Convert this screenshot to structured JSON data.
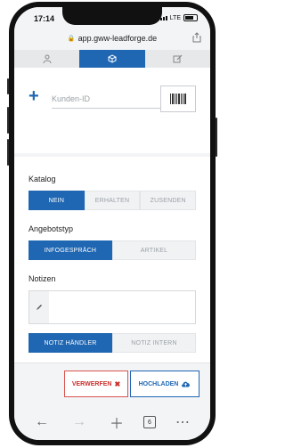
{
  "status": {
    "time": "17:14",
    "network": "LTE"
  },
  "browser": {
    "url": "app.gww-leadforge.de",
    "tab_count": "6"
  },
  "tabs": [
    {
      "icon": "user-icon"
    },
    {
      "icon": "cube-icon",
      "active": true
    },
    {
      "icon": "edit-icon"
    }
  ],
  "customer": {
    "plus": "+",
    "placeholder": "Kunden-ID"
  },
  "katalog": {
    "label": "Katalog",
    "options": [
      "NEIN",
      "ERHALTEN",
      "ZUSENDEN"
    ],
    "selected": "NEIN"
  },
  "angebotstyp": {
    "label": "Angebotstyp",
    "options": [
      "INFOGESPRÄCH",
      "ARTIKEL"
    ],
    "selected": "INFOGESPRÄCH"
  },
  "notizen": {
    "label": "Notizen",
    "options": [
      "NOTIZ HÄNDLER",
      "NOTIZ INTERN"
    ],
    "selected": "NOTIZ HÄNDLER"
  },
  "actions": {
    "discard_label": "VERWERFEN",
    "discard_icon": "✖",
    "upload_label": "HOCHLADEN",
    "upload_icon": "cloud-upload-icon"
  },
  "colors": {
    "accent": "#1f67b3",
    "danger": "#d9534f"
  }
}
